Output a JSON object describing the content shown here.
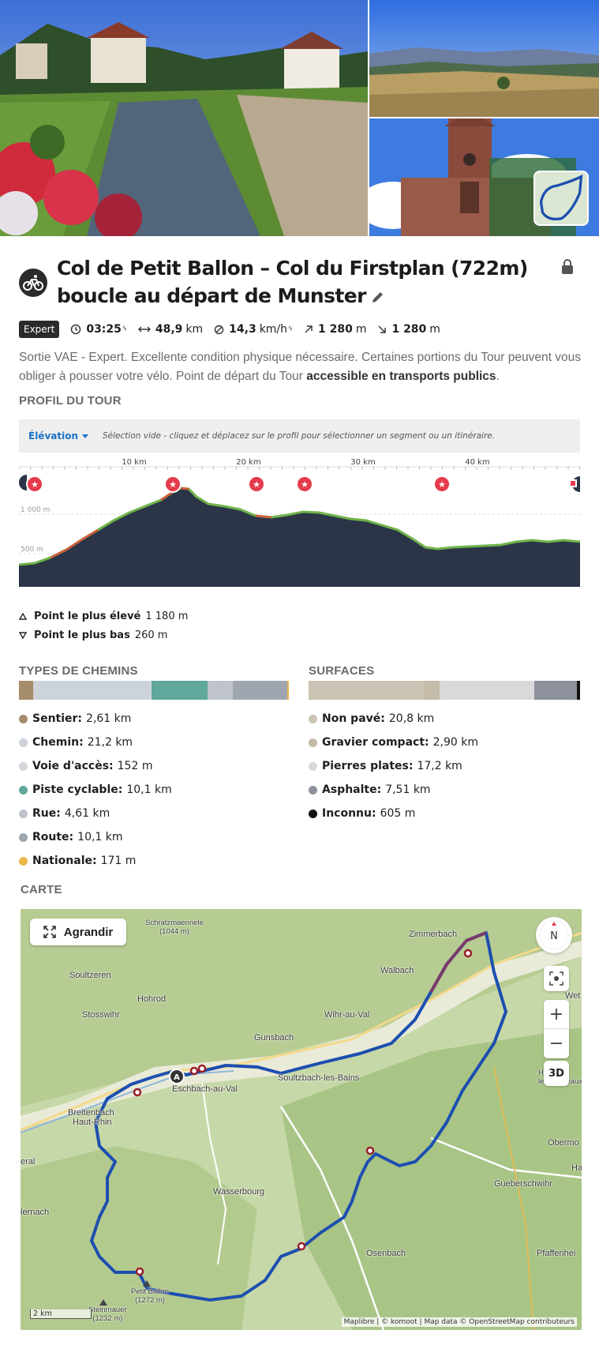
{
  "tour": {
    "title": "Col de Petit Ballon – Col du Firstplan (722m) boucle au départ de Munster",
    "difficulty": "Expert",
    "duration": "03:25",
    "distance_value": "48,9",
    "distance_unit": "km",
    "speed_value": "14,3",
    "speed_unit": "km/h",
    "uphill_value": "1 280",
    "uphill_unit": "m",
    "downhill_value": "1 280",
    "downhill_unit": "m",
    "description": "Sortie VAE - Expert. Excellente condition physique nécessaire. Certaines portions du Tour peuvent vous obliger à pousser votre vélo. Point de départ du Tour ",
    "description_bold": "accessible en transports publics",
    "description_end": "."
  },
  "profile": {
    "heading": "PROFIL DU TOUR",
    "mode_label": "Élévation",
    "hint": "Sélection vide - cliquez et déplacez sur le profil pour sélectionner un segment ou un itinéraire.",
    "km_ticks": [
      "10 km",
      "20 km",
      "30 km",
      "40 km"
    ],
    "elev_ticks": [
      "1 000 m",
      "500 m"
    ],
    "highest_label": "Point le plus élevé",
    "highest_value": "1 180 m",
    "lowest_label": "Point le plus bas",
    "lowest_value": "260 m"
  },
  "way_types": {
    "heading": "TYPES DE CHEMINS",
    "items": [
      {
        "label": "Sentier:",
        "value": "2,61 km",
        "color": "#a58c6a"
      },
      {
        "label": "Chemin:",
        "value": "21,2 km",
        "color": "#cdd3da"
      },
      {
        "label": "Voie d'accès:",
        "value": "152 m",
        "color": "#d3d7dc"
      },
      {
        "label": "Piste cyclable:",
        "value": "10,1 km",
        "color": "#5fa89b"
      },
      {
        "label": "Rue:",
        "value": "4,61 km",
        "color": "#bfc4cb"
      },
      {
        "label": "Route:",
        "value": "10,1 km",
        "color": "#a0a6b0"
      },
      {
        "label": "Nationale:",
        "value": "171 m",
        "color": "#e8b84a"
      }
    ]
  },
  "surfaces": {
    "heading": "SURFACES",
    "items": [
      {
        "label": "Non pavé:",
        "value": "20,8 km",
        "color": "#cbc3b3"
      },
      {
        "label": "Gravier compact:",
        "value": "2,90 km",
        "color": "#c4bba9"
      },
      {
        "label": "Pierres plates:",
        "value": "17,2 km",
        "color": "#d9d9d9"
      },
      {
        "label": "Asphalte:",
        "value": "7,51 km",
        "color": "#8c919b"
      },
      {
        "label": "Inconnu:",
        "value": "605 m",
        "color": "#111111"
      }
    ]
  },
  "map": {
    "heading": "CARTE",
    "expand_label": "Agrandir",
    "compass_label": "N",
    "zoom_in": "+",
    "zoom_out": "−",
    "btn_3d": "3D",
    "scale": "2 km",
    "attribution": "Maplibre | © komoot | Map data © OpenStreetMap contributeurs",
    "start_marker": "A",
    "places": {
      "schratz": "Schratzmaennele",
      "schratz_alt": "(1044 m)",
      "zimmerbach": "Zimmerbach",
      "soultzeren": "Soultzeren",
      "walbach": "Walbach",
      "hohrod": "Hohrod",
      "stosswihr": "Stosswihr",
      "wihr": "Wihr-au-Val",
      "gunsbach": "Gunsbach",
      "eschbach": "Eschbach-au-Val",
      "soultzbach": "Soultzbach-les-Bains",
      "breitenbach": "Breitenbach",
      "hautrhin": "Haut-Rhin",
      "husseren": "Huss",
      "chateaux": "les-Châteaux",
      "wet": "Wet",
      "obermo": "Obermo",
      "ha": "Ha",
      "eral": "eral",
      "wasserbourg": "Wasserbourg",
      "gueberschwihr": "Gueberschwihr",
      "lernach": "lernach",
      "osenbach": "Osenbach",
      "pfaffenheim": "Pfaffenhei",
      "petitballon": "Petit Ballon",
      "petitballon_alt": "(1272 m)",
      "steinmauer": "Steinmauer",
      "steinmauer_alt": "(1232 m)"
    }
  }
}
